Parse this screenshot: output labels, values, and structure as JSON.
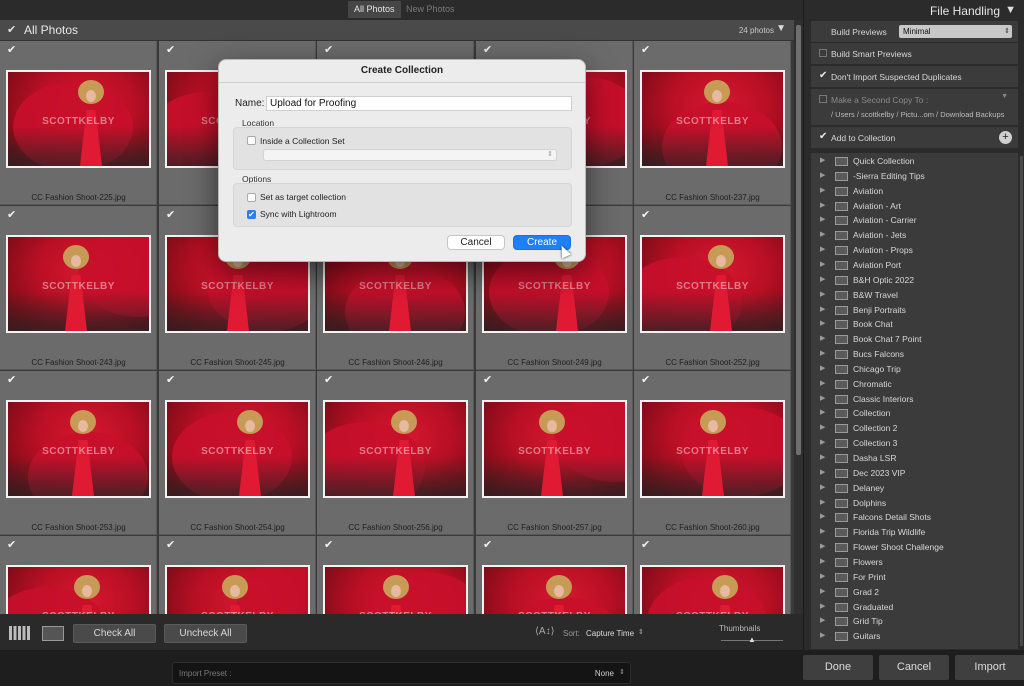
{
  "top_tabs": {
    "all_photos": "All Photos",
    "new_photos": "New Photos"
  },
  "grid_header": {
    "check": "✔",
    "title": "All Photos",
    "count": "24 photos",
    "caret": "▼"
  },
  "photos": [
    {
      "name": "CC Fashion Shoot-225.jpg",
      "checked": "✔"
    },
    {
      "name": "",
      "checked": "✔"
    },
    {
      "name": "",
      "checked": "✔"
    },
    {
      "name": "",
      "checked": "✔"
    },
    {
      "name": "CC Fashion Shoot-237.jpg",
      "checked": "✔"
    },
    {
      "name": "CC Fashion Shoot-243.jpg",
      "checked": "✔"
    },
    {
      "name": "CC Fashion Shoot-245.jpg",
      "checked": "✔"
    },
    {
      "name": "CC Fashion Shoot-246.jpg",
      "checked": "✔"
    },
    {
      "name": "CC Fashion Shoot-249.jpg",
      "checked": "✔"
    },
    {
      "name": "CC Fashion Shoot-252.jpg",
      "checked": "✔"
    },
    {
      "name": "CC Fashion Shoot-253.jpg",
      "checked": "✔"
    },
    {
      "name": "CC Fashion Shoot-254.jpg",
      "checked": "✔"
    },
    {
      "name": "CC Fashion Shoot-256.jpg",
      "checked": "✔"
    },
    {
      "name": "CC Fashion Shoot-257.jpg",
      "checked": "✔"
    },
    {
      "name": "CC Fashion Shoot-260.jpg",
      "checked": "✔"
    },
    {
      "name": "",
      "checked": "✔"
    },
    {
      "name": "",
      "checked": "✔"
    },
    {
      "name": "",
      "checked": "✔"
    },
    {
      "name": "",
      "checked": "✔"
    },
    {
      "name": "",
      "checked": "✔"
    }
  ],
  "watermark": "SCOTTKELBY",
  "right_panel": {
    "title": "File Handling",
    "caret": "▼",
    "build_previews_label": "Build Previews",
    "build_previews_value": "Minimal",
    "build_smart_previews": "Build Smart Previews",
    "dont_import_duplicates": "Don't Import Suspected Duplicates",
    "make_second_copy": "Make a Second Copy To :",
    "second_copy_path": "/ Users / scottkelby / Pictu...om / Download Backups",
    "add_to_collection": "Add to Collection",
    "add_plus": "+",
    "check": "✔",
    "collections": [
      "Quick Collection",
      "-Sierra Editing Tips",
      "Aviation",
      "Aviation - Art",
      "Aviation - Carrier",
      "Aviation - Jets",
      "Aviation - Props",
      "Aviation Port",
      "B&H Optic 2022",
      "B&W Travel",
      "Benji Portraits",
      "Book Chat",
      "Book Chat 7 Point",
      "Bucs Falcons",
      "Chicago Trip",
      "Chromatic",
      "Classic Interiors",
      "Collection",
      "Collection 2",
      "Collection 3",
      "Dasha LSR",
      "Dec 2023 VIP",
      "Delaney",
      "Dolphins",
      "Falcons Detail Shots",
      "Florida Trip Wildlife",
      "Flower Shoot Challenge",
      "Flowers",
      "For Print",
      "Grad 2",
      "Graduated",
      "Grid Tip",
      "Guitars"
    ]
  },
  "toolbar": {
    "check_all": "Check All",
    "uncheck_all": "Uncheck All",
    "sort_label": "Sort:",
    "sort_value": "Capture Time",
    "thumbnails_label": "Thumbnails"
  },
  "bottom_bar": {
    "import_preset_label": "Import Preset :",
    "import_preset_value": "None",
    "done": "Done",
    "cancel": "Cancel",
    "import": "Import"
  },
  "dialog": {
    "title": "Create Collection",
    "name_label": "Name:",
    "name_value": "Upload for Proofing",
    "location_label": "Location",
    "inside_collection_set": "Inside a Collection Set",
    "options_label": "Options",
    "set_as_target": "Set as target collection",
    "sync_with_lightroom": "Sync with Lightroom",
    "sync_checked": "✔",
    "cancel": "Cancel",
    "create": "Create"
  }
}
